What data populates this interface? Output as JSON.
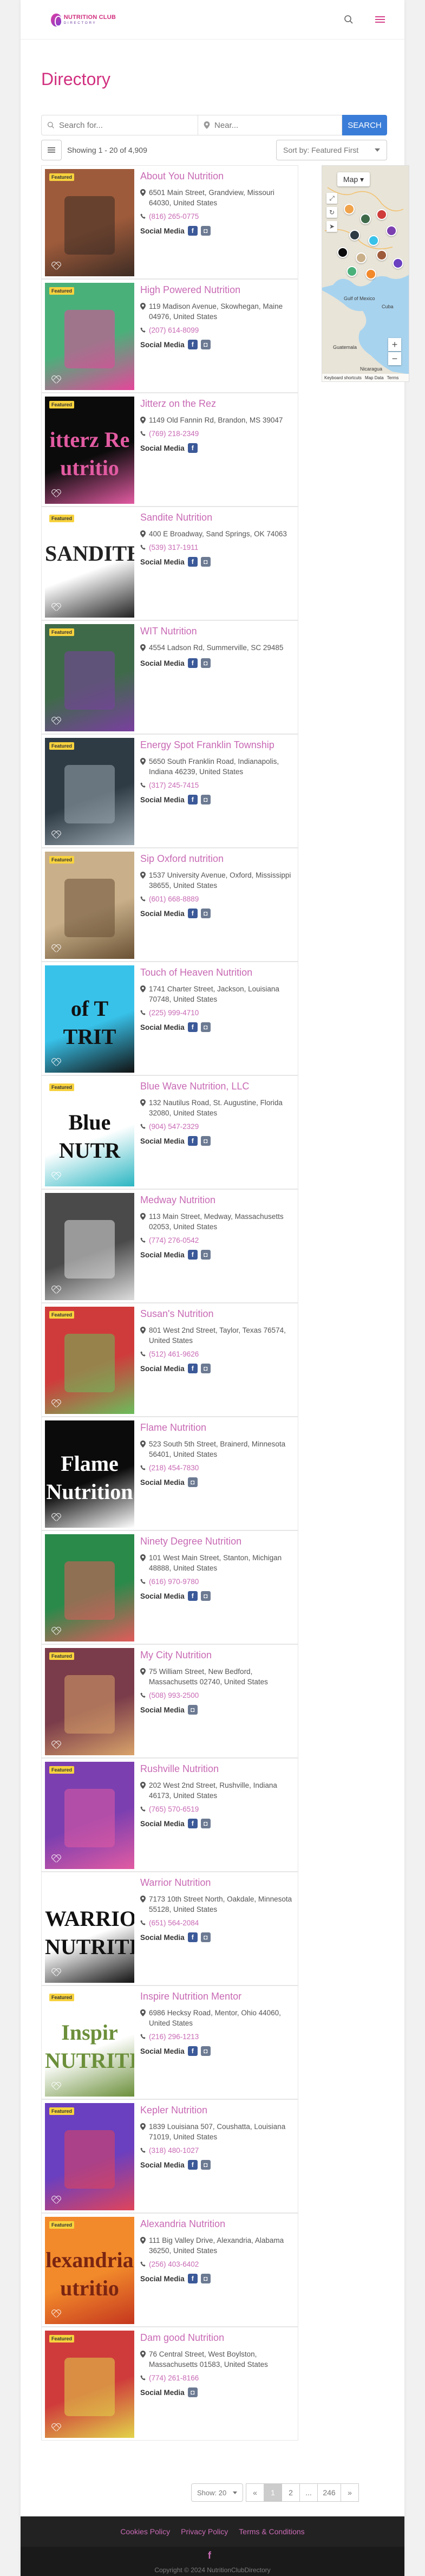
{
  "header": {
    "logo_main": "NUTRITION CLUB",
    "logo_sub": "DIRECTORY"
  },
  "page_title": "Directory",
  "search": {
    "placeholder": "Search for...",
    "near_placeholder": "Near...",
    "button_label": "SEARCH"
  },
  "results": {
    "showing": "Showing 1 - 20 of 4,909",
    "sort_label": "Sort by: Featured First"
  },
  "map": {
    "type_label": "Map",
    "footer_items": [
      "Keyboard shortcuts",
      "Map Data",
      "Terms"
    ],
    "labels": [
      "Gulf of Mexico",
      "Cuba",
      "Guatemala",
      "Nicaragua"
    ]
  },
  "listings": [
    {
      "name": "About You Nutrition",
      "address": "6501 Main Street, Grandview, Missouri 64030, United States",
      "phone": "(816) 265-0775",
      "social": [
        "fb",
        "ig"
      ],
      "featured": true,
      "thumb": {
        "bg": "#9e5b3b",
        "accent": "#3d2c24",
        "text": "",
        "text_color": "#fff"
      }
    },
    {
      "name": "High Powered Nutrition",
      "address": "119 Madison Avenue, Skowhegan, Maine 04976, United States",
      "phone": "(207) 614-8099",
      "social": [
        "fb",
        "ig"
      ],
      "featured": true,
      "thumb": {
        "bg": "#4ab07a",
        "accent": "#e5469a",
        "text": "",
        "text_color": "#fff"
      }
    },
    {
      "name": "Jitterz on the Rez",
      "address": "1149 Old Fannin Rd, Brandon, MS 39047",
      "phone": "(769) 218-2349",
      "social": [
        "fb"
      ],
      "featured": true,
      "thumb": {
        "bg": "#0b0b0b",
        "accent": "#e25ba2",
        "text": "itterz Re utritio",
        "text_color": "#e25ba2"
      }
    },
    {
      "name": "Sandite Nutrition",
      "address": "400 E Broadway, Sand Springs, OK 74063",
      "phone": "(539) 317-1911",
      "social": [
        "fb",
        "ig"
      ],
      "featured": true,
      "thumb": {
        "bg": "#ffffff",
        "accent": "#222",
        "text": "SANDITE",
        "text_color": "#222"
      }
    },
    {
      "name": "WIT Nutrition",
      "address": "4554 Ladson Rd, Summerville, SC 29485",
      "phone": "",
      "social": [
        "fb",
        "ig"
      ],
      "featured": true,
      "thumb": {
        "bg": "#3f6a4a",
        "accent": "#7a3fa0",
        "text": "",
        "text_color": "#fff"
      }
    },
    {
      "name": "Energy Spot Franklin Township",
      "address": "5650 South Franklin Road, Indianapolis, Indiana 46239, United States",
      "phone": "(317) 245-7415",
      "social": [
        "fb",
        "ig"
      ],
      "featured": true,
      "thumb": {
        "bg": "#2e3a44",
        "accent": "#9aa7b0",
        "text": "",
        "text_color": "#fff"
      }
    },
    {
      "name": "Sip Oxford nutrition",
      "address": "1537 University Avenue, Oxford, Mississippi 38655, United States",
      "phone": "(601) 668-8889",
      "social": [
        "fb",
        "ig"
      ],
      "featured": true,
      "thumb": {
        "bg": "#c9b08a",
        "accent": "#6a5134",
        "text": "",
        "text_color": "#fff"
      }
    },
    {
      "name": "Touch of Heaven Nutrition",
      "address": "1741 Charter Street, Jackson, Louisiana 70748, United States",
      "phone": "(225) 999-4710",
      "social": [
        "fb",
        "ig"
      ],
      "featured": false,
      "thumb": {
        "bg": "#38c2ea",
        "accent": "#111",
        "text": "of T TRIT",
        "text_color": "#111"
      }
    },
    {
      "name": "Blue Wave Nutrition, LLC",
      "address": "132 Nautilus Road, St. Augustine, Florida 32080, United States",
      "phone": "(904) 547-2329",
      "social": [
        "fb",
        "ig"
      ],
      "featured": true,
      "thumb": {
        "bg": "#ffffff",
        "accent": "#2bb6c2",
        "text": "Blue NUTR",
        "text_color": "#111"
      }
    },
    {
      "name": "Medway Nutrition",
      "address": "113 Main Street, Medway, Massachusetts 02053, United States",
      "phone": "(774) 276-0542",
      "social": [
        "fb",
        "ig"
      ],
      "featured": false,
      "thumb": {
        "bg": "#4a4a4a",
        "accent": "#ddd",
        "text": "",
        "text_color": "#fff"
      }
    },
    {
      "name": "Susan's Nutrition",
      "address": "801 West 2nd Street, Taylor, Texas 76574, United States",
      "phone": "(512) 461-9626",
      "social": [
        "fb",
        "ig"
      ],
      "featured": true,
      "thumb": {
        "bg": "#cf3b3b",
        "accent": "#6bbd5b",
        "text": "",
        "text_color": "#fff"
      }
    },
    {
      "name": "Flame Nutrition",
      "address": "523 South 5th Street, Brainerd, Minnesota 56401, United States",
      "phone": "(218) 454-7830",
      "social": [
        "ig"
      ],
      "featured": false,
      "thumb": {
        "bg": "#0b0b0b",
        "accent": "#fff",
        "text": "Flame Nutrition",
        "text_color": "#fff"
      }
    },
    {
      "name": "Ninety Degree Nutrition",
      "address": "101 West Main Street, Stanton, Michigan 48888, United States",
      "phone": "(616) 970-9780",
      "social": [
        "fb",
        "ig"
      ],
      "featured": false,
      "thumb": {
        "bg": "#2a8a4a",
        "accent": "#e25b5b",
        "text": "",
        "text_color": "#fff"
      }
    },
    {
      "name": "My City Nutrition",
      "address": "75 William Street, New Bedford, Massachusetts 02740, United States",
      "phone": "(508) 993-2500",
      "social": [
        "ig"
      ],
      "featured": true,
      "thumb": {
        "bg": "#7a3b4a",
        "accent": "#d9a36a",
        "text": "",
        "text_color": "#fff"
      }
    },
    {
      "name": "Rushville Nutrition",
      "address": "202 West 2nd Street, Rushville, Indiana 46173, United States",
      "phone": "(765) 570-6519",
      "social": [
        "fb",
        "ig"
      ],
      "featured": true,
      "thumb": {
        "bg": "#7b3fb0",
        "accent": "#e25ba2",
        "text": "",
        "text_color": "#fff"
      }
    },
    {
      "name": "Warrior Nutrition",
      "address": "7173 10th Street North, Oakdale, Minnesota 55128, United States",
      "phone": "(651) 564-2084",
      "social": [
        "fb",
        "ig"
      ],
      "featured": false,
      "thumb": {
        "bg": "#ffffff",
        "accent": "#111",
        "text": "WARRIOR NUTRITION",
        "text_color": "#111"
      }
    },
    {
      "name": "Inspire Nutrition Mentor",
      "address": "6986 Hecksy Road, Mentor, Ohio 44060, United States",
      "phone": "(216) 296-1213",
      "social": [
        "fb",
        "ig"
      ],
      "featured": true,
      "thumb": {
        "bg": "#ffffff",
        "accent": "#6b8f3a",
        "text": "Inspir NUTRITION",
        "text_color": "#6b8f3a"
      }
    },
    {
      "name": "Kepler Nutrition",
      "address": "1839 Louisiana 507, Coushatta, Louisiana 71019, United States",
      "phone": "(318) 480-1027",
      "social": [
        "fb",
        "ig"
      ],
      "featured": true,
      "thumb": {
        "bg": "#6a3fc0",
        "accent": "#e0445a",
        "text": "",
        "text_color": "#fff"
      }
    },
    {
      "name": "Alexandria Nutrition",
      "address": "111 Big Valley Drive, Alexandria, Alabama 36250, United States",
      "phone": "(256) 403-6402",
      "social": [
        "fb",
        "ig"
      ],
      "featured": true,
      "thumb": {
        "bg": "#f28a2b",
        "accent": "#c4361e",
        "text": "lexandria utritio",
        "text_color": "#7a2512"
      }
    },
    {
      "name": "Dam good Nutrition",
      "address": "76 Central Street, West Boylston, Massachusetts 01583, United States",
      "phone": "(774) 261-8166",
      "social": [
        "ig"
      ],
      "featured": true,
      "thumb": {
        "bg": "#cf3b3b",
        "accent": "#e2d34a",
        "text": "",
        "text_color": "#fff"
      }
    }
  ],
  "pagination": {
    "show_label": "Show: 20",
    "prev": "«",
    "pages": [
      "1",
      "2",
      "...",
      "246"
    ],
    "next": "»"
  },
  "footer": {
    "links": [
      "Cookies Policy",
      "Privacy Policy",
      "Terms & Conditions"
    ],
    "facebook": "f",
    "copyright": "Copyright © 2024 NutritionClubDirectory"
  },
  "colors": {
    "accent": "#d1307f",
    "link": "#c86ab4",
    "button": "#3a7dd8"
  },
  "icons": [
    "search-icon",
    "menu-icon",
    "map-pin-icon",
    "phone-icon",
    "facebook-icon",
    "instagram-icon",
    "heart-icon",
    "list-icon"
  ]
}
